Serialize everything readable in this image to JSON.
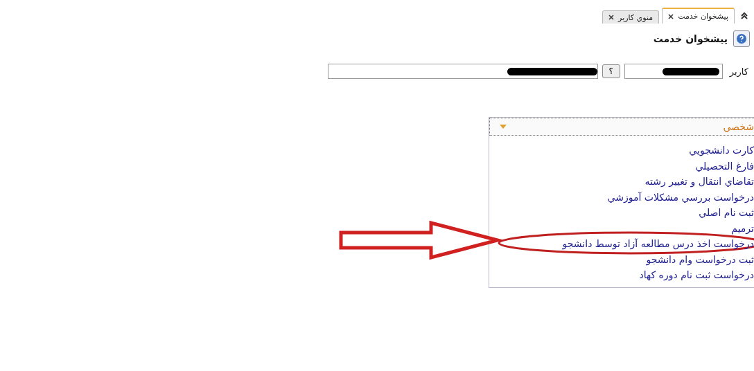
{
  "tabs": [
    {
      "label": "پیشخوان خدمت",
      "selected": true
    },
    {
      "label": "منوي كاربر",
      "selected": false
    }
  ],
  "page_title": "پیشخوان خدمت",
  "user_field": {
    "label": "كاربر",
    "help_label": "؟"
  },
  "panel": {
    "title": "شخصي",
    "items": [
      {
        "label": "كارت دانشجويي"
      },
      {
        "label": "فارغ التحصيلي"
      },
      {
        "label": "تقاضاي انتقال و تغيير رشته"
      },
      {
        "label": "درخواست بررسي مشكلات آموزشي"
      },
      {
        "label": "ثبت نام اصلي"
      },
      {
        "label": "ترميم"
      },
      {
        "label": "درخواست اخذ درس مطالعه آزاد توسط دانشجو",
        "highlighted": true
      },
      {
        "label": "ثبت درخواست وام دانشجو"
      },
      {
        "label": "درخواست ثبت نام دوره كهاد"
      }
    ]
  }
}
